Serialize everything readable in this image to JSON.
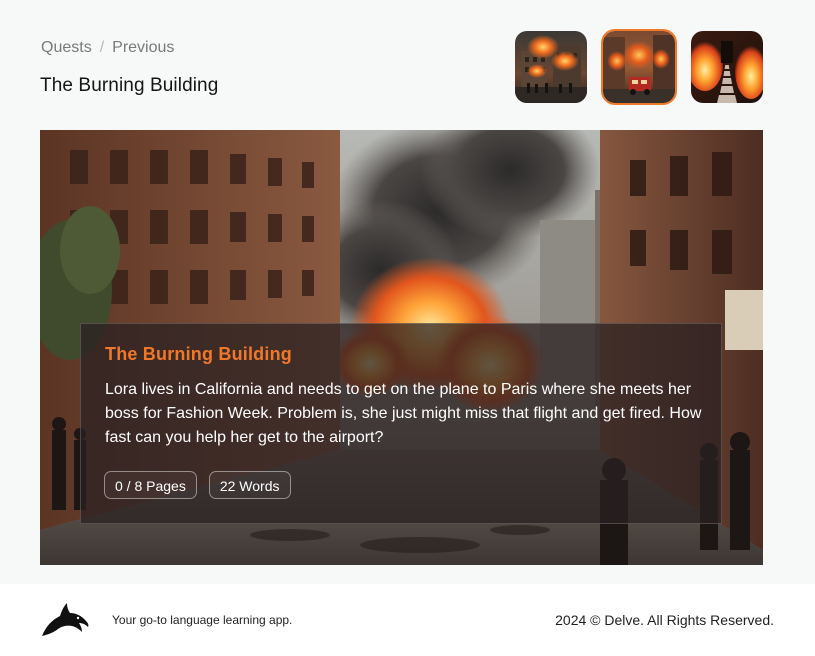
{
  "breadcrumb": {
    "root": "Quests",
    "separator": "/",
    "current": "Previous"
  },
  "page_title": "The Burning Building",
  "thumbnails": [
    {
      "icon": "burning-street-scene",
      "selected": false
    },
    {
      "icon": "fire-truck-scene",
      "selected": true
    },
    {
      "icon": "burning-staircase-scene",
      "selected": false
    }
  ],
  "hero": {
    "image": "burning-city-street",
    "card": {
      "title": "The Burning Building",
      "description": "Lora lives in California and needs to get on the plane to Paris where she meets her boss for Fashion Week. Problem is, she just might miss that flight and get fired. How fast can you help her get to the airport?",
      "pages": "0 / 8 Pages",
      "words": "22 Words"
    }
  },
  "footer": {
    "logo_icon": "dolphin-logo",
    "tagline": "Your go-to language learning app.",
    "copyright": "2024 © Delve. All Rights Reserved."
  },
  "colors": {
    "accent": "#f07a2b",
    "background": "#f7f8f8"
  }
}
